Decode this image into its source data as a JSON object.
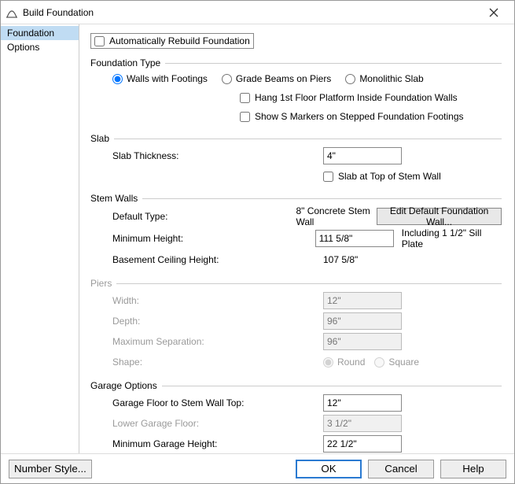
{
  "window": {
    "title": "Build Foundation"
  },
  "sidebar": {
    "items": [
      {
        "label": "Foundation",
        "selected": true
      },
      {
        "label": "Options",
        "selected": false
      }
    ]
  },
  "auto_rebuild": {
    "label": "Automatically Rebuild Foundation",
    "checked": false
  },
  "foundation_type": {
    "header": "Foundation Type",
    "options": [
      {
        "label": "Walls with Footings",
        "checked": true
      },
      {
        "label": "Grade Beams on Piers",
        "checked": false
      },
      {
        "label": "Monolithic Slab",
        "checked": false
      }
    ],
    "sub_checks": [
      {
        "label": "Hang 1st Floor Platform Inside Foundation Walls",
        "checked": false
      },
      {
        "label": "Show S Markers on Stepped Foundation Footings",
        "checked": false
      }
    ]
  },
  "slab": {
    "header": "Slab",
    "thickness_label": "Slab Thickness:",
    "thickness_value": "4\"",
    "top_check": {
      "label": "Slab at Top of Stem Wall",
      "checked": false
    }
  },
  "stem_walls": {
    "header": "Stem Walls",
    "default_type_label": "Default Type:",
    "default_type_value": "8\" Concrete Stem Wall",
    "edit_button": "Edit Default Foundation Wall...",
    "min_height_label": "Minimum Height:",
    "min_height_value": "111 5/8\"",
    "min_height_suffix": "Including 1 1/2\" Sill Plate",
    "basement_label": "Basement Ceiling Height:",
    "basement_value": "107 5/8\""
  },
  "piers": {
    "header": "Piers",
    "enabled": false,
    "width_label": "Width:",
    "width_value": "12\"",
    "depth_label": "Depth:",
    "depth_value": "96\"",
    "maxsep_label": "Maximum Separation:",
    "maxsep_value": "96\"",
    "shape_label": "Shape:",
    "shape_options": [
      {
        "label": "Round",
        "checked": true
      },
      {
        "label": "Square",
        "checked": false
      }
    ]
  },
  "garage": {
    "header": "Garage Options",
    "floor_top_label": "Garage Floor to Stem Wall Top:",
    "floor_top_value": "12\"",
    "lower_label": "Lower Garage Floor:",
    "lower_value": "3 1/2\"",
    "lower_enabled": false,
    "min_height_label": "Minimum Garage Height:",
    "min_height_value": "22 1/2\""
  },
  "footer": {
    "number_style": "Number Style...",
    "ok": "OK",
    "cancel": "Cancel",
    "help": "Help"
  }
}
